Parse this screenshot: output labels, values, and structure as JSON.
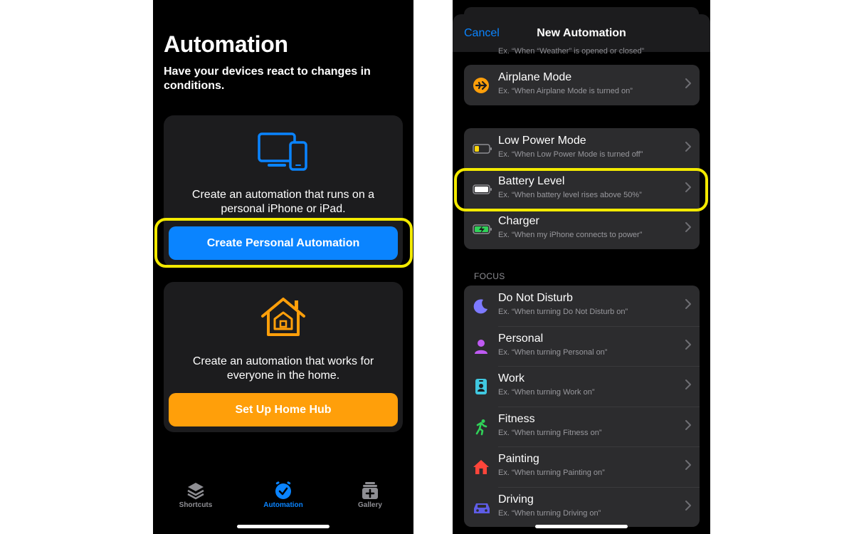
{
  "left": {
    "title": "Automation",
    "subtitle": "Have your devices react to changes in conditions.",
    "personal_card": {
      "text": "Create an automation that runs on a personal iPhone or iPad.",
      "button": "Create Personal Automation"
    },
    "home_card": {
      "text": "Create an automation that works for everyone in the home.",
      "button": "Set Up Home Hub"
    },
    "tabs": [
      {
        "label": "Shortcuts",
        "icon": "layers-icon"
      },
      {
        "label": "Automation",
        "icon": "clock-check-icon"
      },
      {
        "label": "Gallery",
        "icon": "gallery-icon"
      }
    ]
  },
  "right": {
    "nav": {
      "cancel": "Cancel",
      "title": "New Automation"
    },
    "peek_text": "Ex. “When “Weather” is opened or closed”",
    "group1": [
      {
        "title": "Airplane Mode",
        "subtitle": "Ex. “When Airplane Mode is turned on”",
        "icon": "airplane-icon"
      }
    ],
    "group2": [
      {
        "title": "Low Power Mode",
        "subtitle": "Ex. “When Low Power Mode is turned off”",
        "icon": "battery-low-icon"
      },
      {
        "title": "Battery Level",
        "subtitle": "Ex. “When battery level rises above 50%”",
        "icon": "battery-full-icon"
      },
      {
        "title": "Charger",
        "subtitle": "Ex. “When my iPhone connects to power”",
        "icon": "battery-charging-icon"
      }
    ],
    "focus_label": "FOCUS",
    "focus": [
      {
        "title": "Do Not Disturb",
        "subtitle": "Ex. “When turning Do Not Disturb on”",
        "icon": "moon-icon"
      },
      {
        "title": "Personal",
        "subtitle": "Ex. “When turning Personal on”",
        "icon": "person-icon"
      },
      {
        "title": "Work",
        "subtitle": "Ex. “When turning Work on”",
        "icon": "badge-icon"
      },
      {
        "title": "Fitness",
        "subtitle": "Ex. “When turning Fitness on”",
        "icon": "running-icon"
      },
      {
        "title": "Painting",
        "subtitle": "Ex. “When turning Painting on”",
        "icon": "house-icon"
      },
      {
        "title": "Driving",
        "subtitle": "Ex. “When turning Driving on”",
        "icon": "car-icon"
      }
    ]
  },
  "colors": {
    "accent_blue": "#0a84ff",
    "accent_orange": "#ff9f0a",
    "highlight_yellow": "#f3ea00",
    "card_bg": "#1c1c1e",
    "row_bg": "#2c2c2e"
  }
}
